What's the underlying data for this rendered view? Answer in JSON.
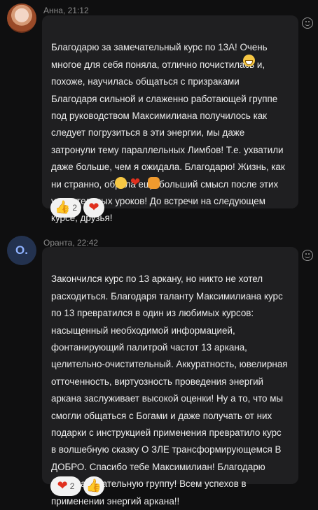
{
  "messages": [
    {
      "author": "Анна",
      "time": "21:12",
      "meta": "Анна, 21:12",
      "avatar_letter": "",
      "text": "Благодарю за замечательный курс по 13А! Очень\nмногое для себя поняла, отлично почистилась и,\nпохоже, научилась общаться с призраками\nБлагодаря сильной и слаженно работающей группе\nпод руководством Максимилиана получилось как\nследует погрузиться в эти энергии, мы даже\nзатронули тему параллельных Лимбов! Т.е. ухватили\nдаже больше, чем я ожидала. Благодарю! Жизнь, как\nни странно, обрела ещё больший смысл после этих\nудивительных уроков! До встречи на следующем\nкурсе, друзья!",
      "reactions": [
        {
          "icon": "thumbs-up-icon",
          "glyph": "👍",
          "count": "2"
        },
        {
          "icon": "heart-icon",
          "glyph": "❤",
          "count": ""
        }
      ]
    },
    {
      "author": "Оранта",
      "time": "22:42",
      "meta": "Оранта, 22:42",
      "avatar_letter": "О.",
      "text": "Закончился курс по 13 аркану, но никто не хотел\nрасходиться. Благодаря таланту Максимилиана курс\nпо 13 превратился в один из любимых курсов:\nнасыщенный необходимой информацией,\nфонтанирующий палитрой частот 13 аркана,\nцелительно-очистительный. Аккуратность, ювелирная\nотточенность, виртуозность проведения энергий\nаркана заслуживает высокой оценки! Ну а то, что мы\nсмогли общаться с Богами и даже получать от них\nподарки с инструкцией применения превратило курс\nв волшебную сказку О ЗЛЕ трансформирующемся  В\nДОБРО. Спасибо тебе Максимилиан!  Благодарю\nнашу замечательную группу! Всем успехов в\nприменении энергий аркана!!",
      "reactions": [
        {
          "icon": "heart-icon",
          "glyph": "❤",
          "count": "2"
        },
        {
          "icon": "thumbs-up-icon",
          "glyph": "👍",
          "count": ""
        }
      ]
    }
  ],
  "colors": {
    "background": "#0f0f10",
    "bubble": "#1f1f21",
    "meta_text": "#8b8b8b",
    "heart": "#e0301e"
  }
}
